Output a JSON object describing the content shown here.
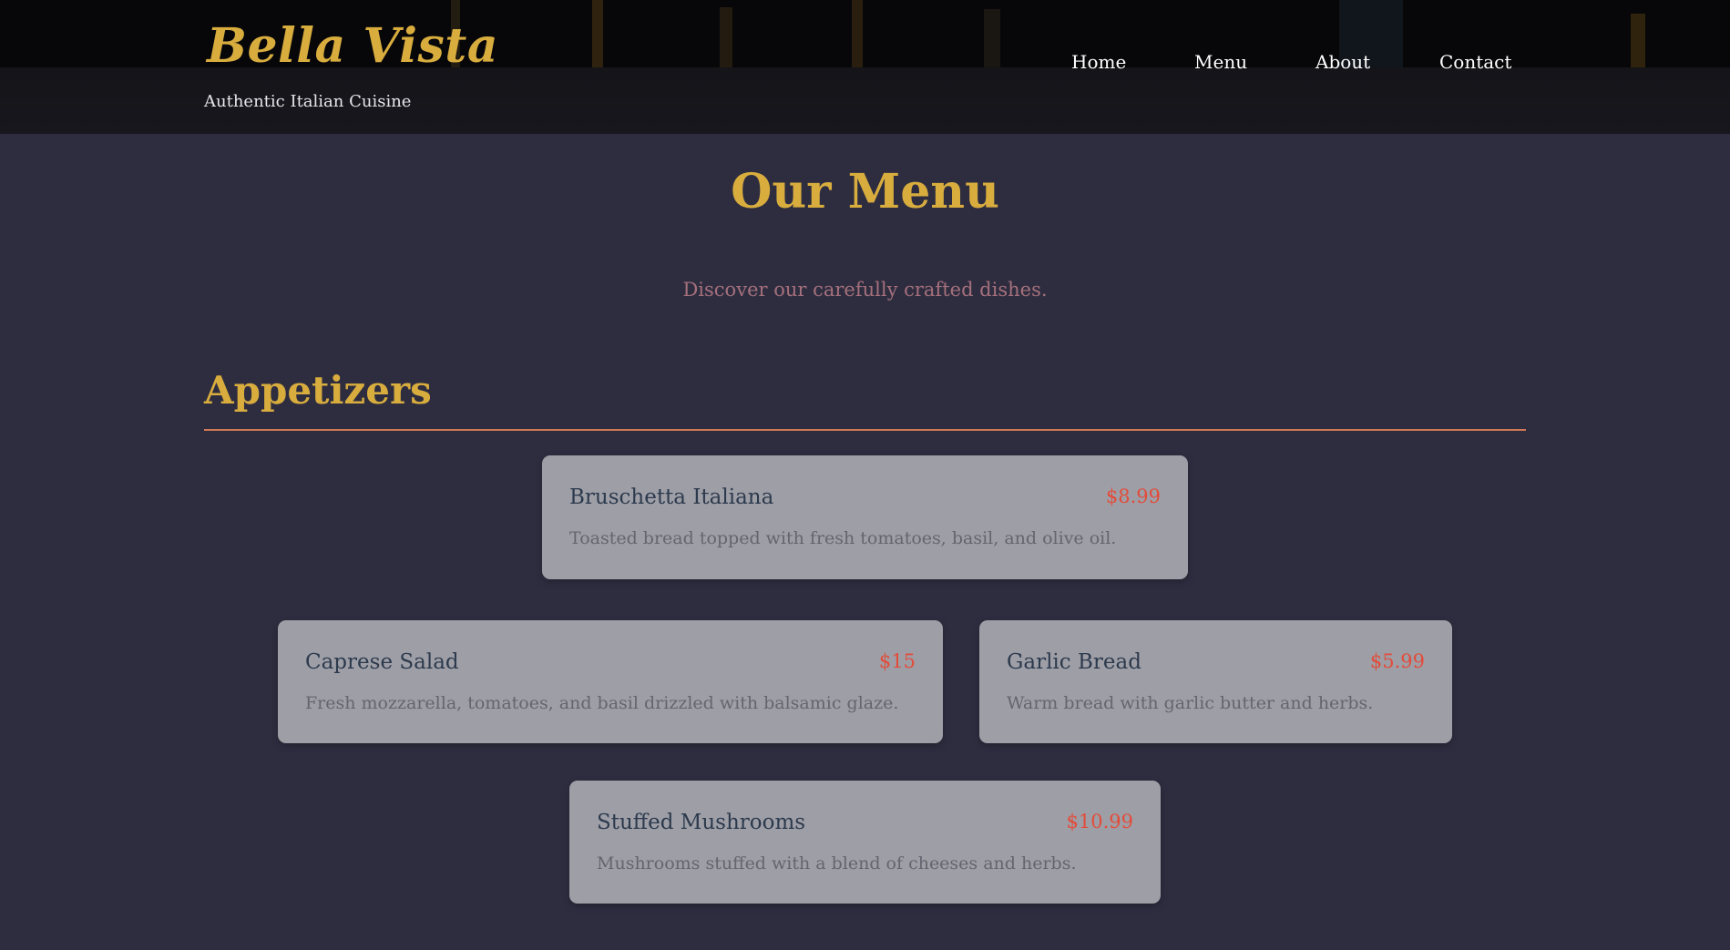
{
  "header": {
    "title": "Bella Vista",
    "subtitle": "Authentic Italian Cuisine",
    "nav": [
      "Home",
      "Menu",
      "About",
      "Contact"
    ]
  },
  "main": {
    "title": "Our Menu",
    "subtitle": "Discover our carefully crafted dishes.",
    "section": {
      "title": "Appetizers",
      "items": [
        {
          "name": "Bruschetta Italiana",
          "price": "$8.99",
          "description": "Toasted bread topped with fresh tomatoes, basil, and olive oil."
        },
        {
          "name": "Caprese Salad",
          "price": "$15",
          "description": "Fresh mozzarella, tomatoes, and basil drizzled with balsamic glaze."
        },
        {
          "name": "Garlic Bread",
          "price": "$5.99",
          "description": "Warm bread with garlic butter and herbs."
        },
        {
          "name": "Stuffed Mushrooms",
          "price": "$10.99",
          "description": "Mushrooms stuffed with a blend of cheeses and herbs."
        }
      ]
    }
  },
  "colors": {
    "accent_gold": "#d8ad3e",
    "price_red": "#e34c3a",
    "background": "#2e2d40",
    "card": "#9e9ea6",
    "rule": "#d27a56"
  }
}
